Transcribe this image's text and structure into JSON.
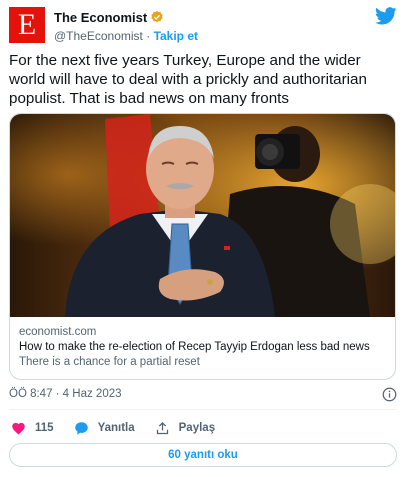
{
  "author": {
    "name": "The Economist",
    "logo_letter": "E",
    "handle": "@TheEconomist",
    "separator": " · ",
    "follow_label": "Takip et",
    "verified_color": "#e8a41c",
    "brand_color": "#e3120b"
  },
  "tweet": {
    "text": "For the next five years Turkey, Europe and the wider world will have to deal with a prickly and authoritarian populist. That is bad news on many fronts"
  },
  "link_card": {
    "domain": "economist.com",
    "title": "How to make the re-election of Recep Tayyip Erdogan less bad news",
    "description": "There is a chance for a partial reset"
  },
  "meta": {
    "timestamp": "ÖÖ 8:47 · 4 Haz 2023"
  },
  "actions": {
    "like_count": "115",
    "reply_label": "Yanıtla",
    "share_label": "Paylaş"
  },
  "footer": {
    "replies_button": "60 yanıtı oku"
  },
  "colors": {
    "accent": "#1d9bf0",
    "like": "#f91880",
    "secondary_text": "#536471"
  }
}
